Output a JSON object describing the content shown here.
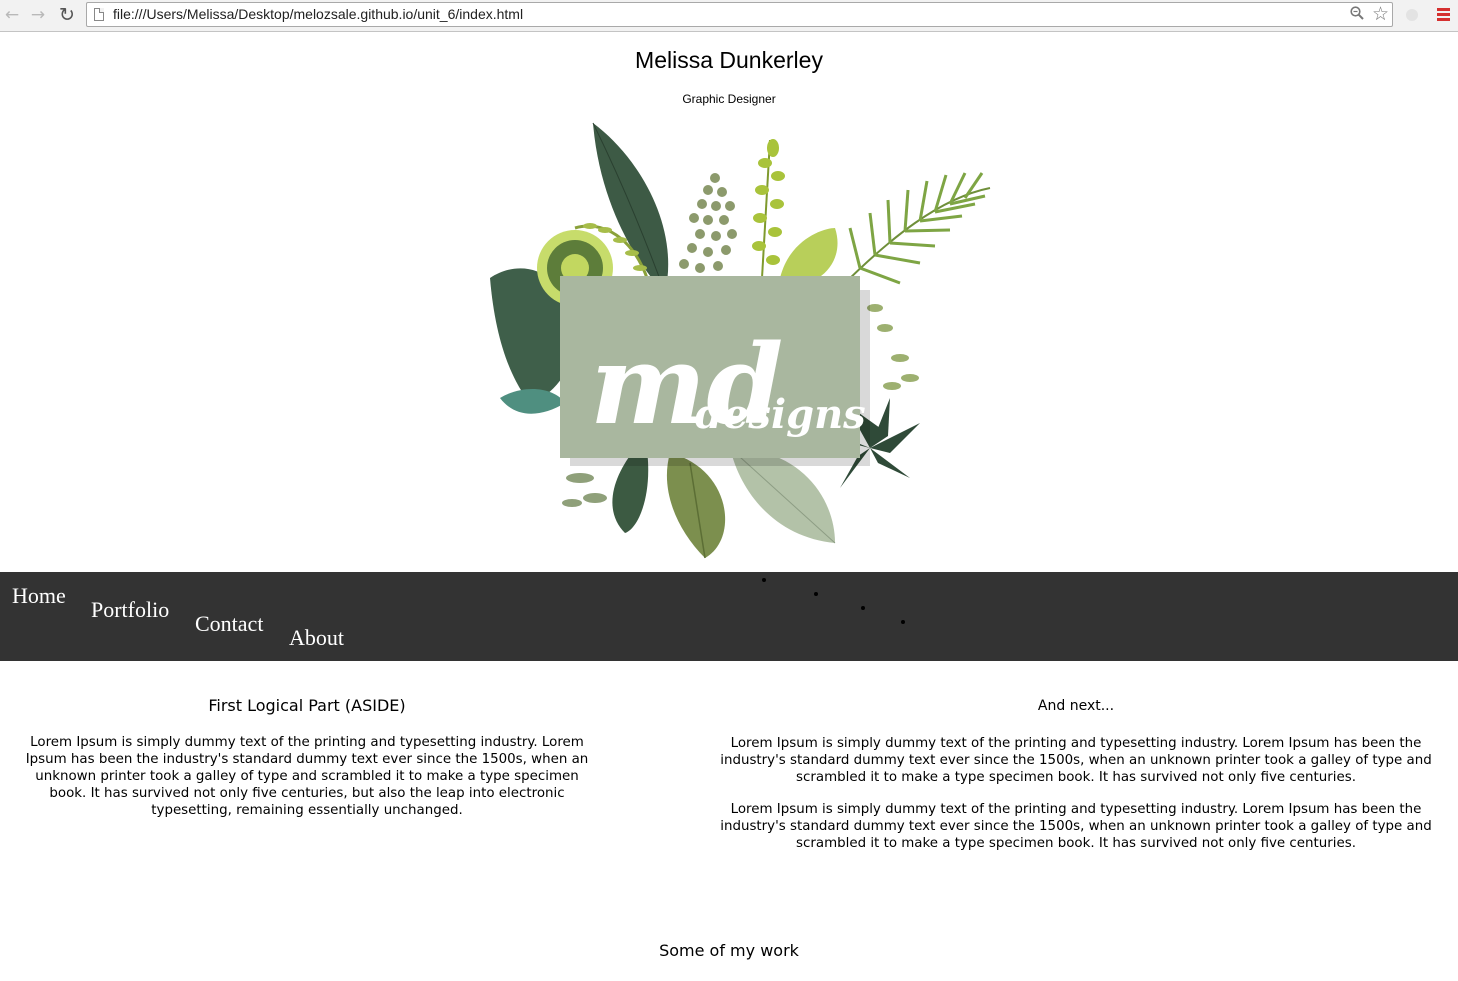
{
  "browser": {
    "url": "file:///Users/Melissa/Desktop/melozsale.github.io/unit_6/index.html",
    "icons": [
      "back-icon",
      "forward-icon",
      "reload-icon",
      "page-icon",
      "zoom-icon",
      "bookmark-star-icon",
      "extension-icon",
      "menu-icon"
    ]
  },
  "header": {
    "title": "Melissa Dunkerley",
    "subtitle": "Graphic Designer",
    "logo_text_1": "md",
    "logo_text_2": "designs"
  },
  "nav": {
    "items": [
      {
        "label": "Home"
      },
      {
        "label": "Portfolio"
      },
      {
        "label": "Contact"
      },
      {
        "label": "About"
      }
    ]
  },
  "aside": {
    "heading": "First Logical Part (ASIDE)",
    "text": "Lorem Ipsum is simply dummy text of the printing and typesetting industry. Lorem Ipsum has been the industry's standard dummy text ever since the 1500s, when an unknown printer took a galley of type and scrambled it to make a type specimen book. It has survived not only five centuries, but also the leap into electronic typesetting, remaining essentially unchanged."
  },
  "section": {
    "heading": "And next...",
    "paragraphs": [
      "Lorem Ipsum is simply dummy text of the printing and typesetting industry. Lorem Ipsum has been the industry's standard dummy text ever since the 1500s, when an unknown printer took a galley of type and scrambled it to make a type specimen book. It has survived not only five centuries.",
      "Lorem Ipsum is simply dummy text of the printing and typesetting industry. Lorem Ipsum has been the industry's standard dummy text ever since the 1500s, when an unknown printer took a galley of type and scrambled it to make a type specimen book. It has survived not only five centuries."
    ]
  },
  "work": {
    "heading": "Some of my work"
  },
  "colors": {
    "navbar": "#333333",
    "logo_card": "#a9b79f",
    "menu_accent": "#d5302f"
  }
}
